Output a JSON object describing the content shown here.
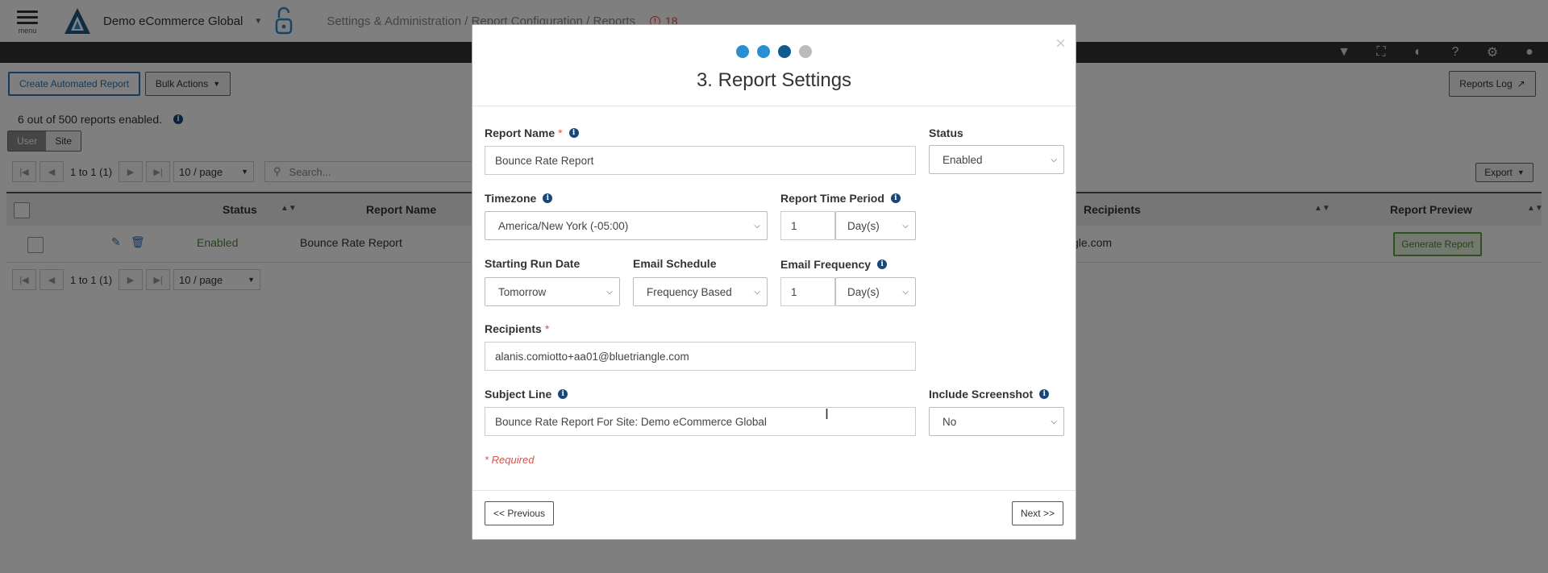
{
  "header": {
    "menu_label": "menu",
    "site_name": "Demo eCommerce Global",
    "breadcrumb": "Settings & Administration / Report Configuration / Reports",
    "alert_count": "18"
  },
  "toolbar": {
    "create_label": "Create Automated Report",
    "bulk_label": "Bulk Actions",
    "reports_log_label": "Reports Log",
    "export_label": "Export"
  },
  "summary": {
    "count_text": "6 out of 500 reports enabled.",
    "seg_user": "User",
    "seg_site": "Site"
  },
  "pager": {
    "range_text": "1 to 1 (1)",
    "per_page": "10 / page",
    "search_placeholder": "Search..."
  },
  "table": {
    "headers": {
      "status": "Status",
      "report_name": "Report Name",
      "recipients": "Recipients",
      "report_preview": "Report Preview"
    },
    "row": {
      "status": "Enabled",
      "report_name": "Bounce Rate Report",
      "recipients": "gle.com",
      "generate_label": "Generate Report"
    }
  },
  "modal": {
    "title": "3. Report Settings",
    "close": "×",
    "steps": [
      "#2a8fd0",
      "#2a8fd0",
      "#115a8f",
      "#bbbbbb"
    ],
    "report_name_label": "Report Name",
    "report_name_value": "Bounce Rate Report",
    "status_label": "Status",
    "status_value": "Enabled",
    "timezone_label": "Timezone",
    "timezone_value": "America/New York (-05:00)",
    "period_label": "Report Time Period",
    "period_number": "1",
    "period_unit": "Day(s)",
    "start_label": "Starting Run Date",
    "start_value": "Tomorrow",
    "schedule_label": "Email Schedule",
    "schedule_value": "Frequency Based",
    "frequency_label": "Email Frequency",
    "frequency_number": "1",
    "frequency_unit": "Day(s)",
    "recipients_label": "Recipients",
    "recipients_value": "alanis.comiotto+aa01@bluetriangle.com",
    "subject_label": "Subject Line",
    "subject_value": "Bounce Rate Report For Site: Demo eCommerce Global",
    "screenshot_label": "Include Screenshot",
    "screenshot_value": "No",
    "required_note": "* Required",
    "prev_label": "<< Previous",
    "next_label": "Next >>",
    "required_star": "*",
    "info_glyph": "i"
  },
  "colors": {
    "accent_blue": "#2a74b6",
    "enabled_green": "#4a8a2e",
    "alert_red": "#d9534f"
  }
}
